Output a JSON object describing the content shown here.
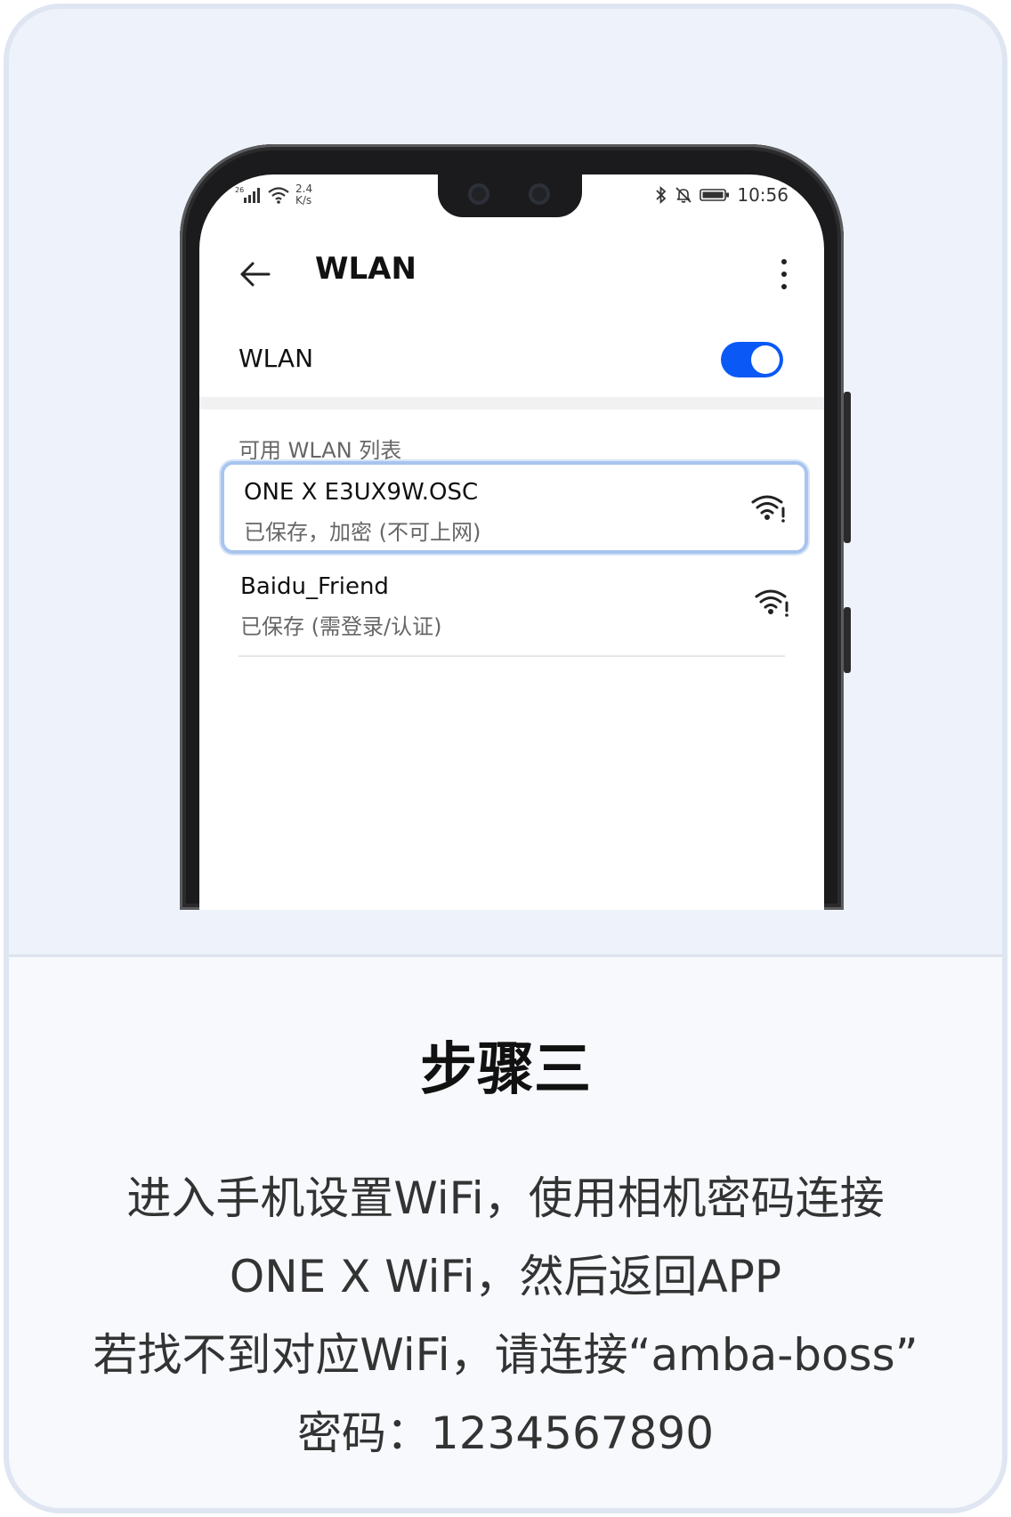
{
  "phone": {
    "status_bar": {
      "net_speed_value": "2.4",
      "net_speed_unit": "K/s",
      "time": "10:56"
    },
    "app_bar": {
      "title": "WLAN"
    },
    "wlan_toggle": {
      "label": "WLAN",
      "enabled": true
    },
    "section_label": "可用 WLAN 列表",
    "networks": [
      {
        "name": "ONE X E3UX9W.OSC",
        "status": "已保存，加密 (不可上网)",
        "icon": "wifi-warning-icon",
        "highlighted": true
      },
      {
        "name": "Baidu_Friend",
        "status": "已保存 (需登录/认证)",
        "icon": "wifi-warning-icon",
        "highlighted": false
      }
    ]
  },
  "step": {
    "title": "步骤三",
    "lines": [
      "进入手机设置WiFi，使用相机密码连接",
      "ONE X WiFi，然后返回APP",
      "若找不到对应WiFi，请连接“amba-boss”",
      "密码：1234567890"
    ]
  },
  "colors": {
    "toggle_on": "#0a59f7",
    "highlight_border": "#a8c4ef",
    "background": "#eef3fb"
  }
}
